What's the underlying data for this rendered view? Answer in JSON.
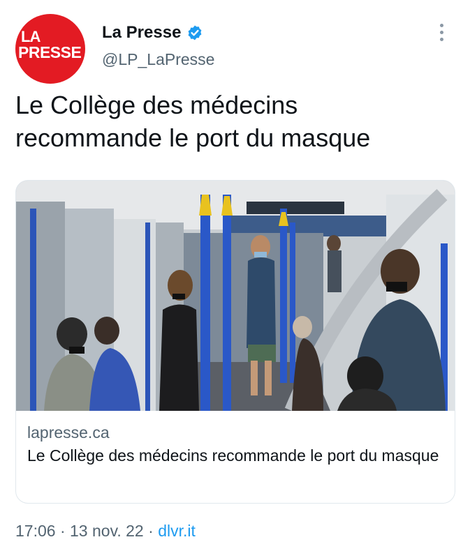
{
  "account": {
    "display_name": "La Presse",
    "handle": "@LP_LaPresse",
    "avatar_logo": {
      "line1": "LA",
      "line2": "PRESSE"
    },
    "verified": true
  },
  "tweet": {
    "text": "Le Collège des médecins recommande le port du masque"
  },
  "link_card": {
    "image_alt": "Passengers wearing masks inside a metro car",
    "domain": "lapresse.ca",
    "title": "Le Collège des médecins recommande le port du masque"
  },
  "footer": {
    "time": "17:06",
    "separator1": " · ",
    "date": "13 nov. 22",
    "separator2": " · ",
    "source": "dlvr.it"
  },
  "colors": {
    "brand_red": "#e31b23",
    "link_blue": "#1d9bf0",
    "verified_blue": "#1d9bf0",
    "secondary_text": "#536471"
  },
  "icons": {
    "verified": "verified-badge-icon",
    "more": "more-options-icon"
  }
}
